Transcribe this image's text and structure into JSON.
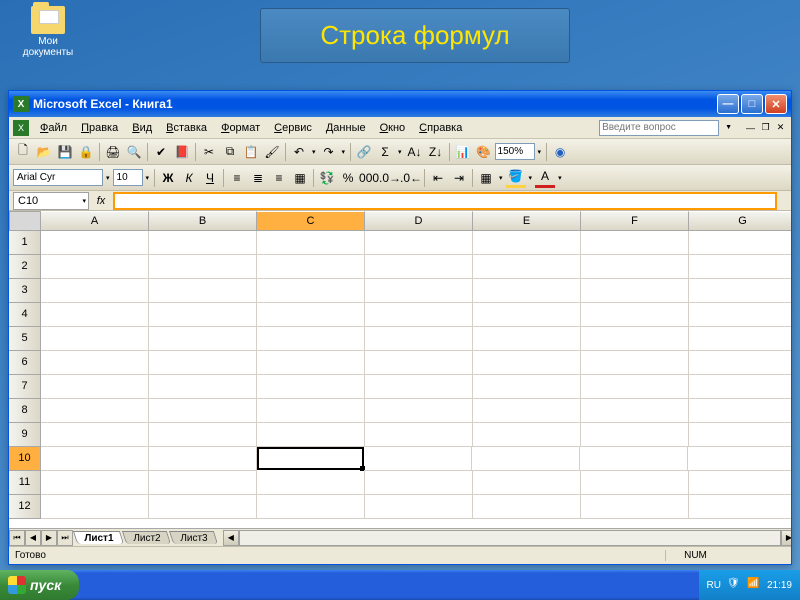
{
  "desktop": {
    "my_documents": "Мои документы"
  },
  "callout": {
    "text": "Строка формул"
  },
  "window": {
    "title": "Microsoft Excel - Книга1",
    "help_placeholder": "Введите вопрос"
  },
  "menu": {
    "file": "Файл",
    "edit": "Правка",
    "view": "Вид",
    "insert": "Вставка",
    "format": "Формат",
    "tools": "Сервис",
    "data": "Данные",
    "window": "Окно",
    "help": "Справка"
  },
  "toolbar": {
    "font": "Arial Cyr",
    "size": "10",
    "zoom": "150%"
  },
  "formula": {
    "namebox": "C10",
    "fx": "fx"
  },
  "grid": {
    "columns": [
      "A",
      "B",
      "C",
      "D",
      "E",
      "F",
      "G"
    ],
    "rows": [
      "1",
      "2",
      "3",
      "4",
      "5",
      "6",
      "7",
      "8",
      "9",
      "10",
      "11",
      "12"
    ],
    "active_col_index": 2,
    "active_row_index": 9
  },
  "tabs": {
    "sheet1": "Лист1",
    "sheet2": "Лист2",
    "sheet3": "Лист3"
  },
  "status": {
    "ready": "Готово",
    "num": "NUM"
  },
  "taskbar": {
    "start": "пуск",
    "lang": "RU",
    "clock": "21:19"
  }
}
